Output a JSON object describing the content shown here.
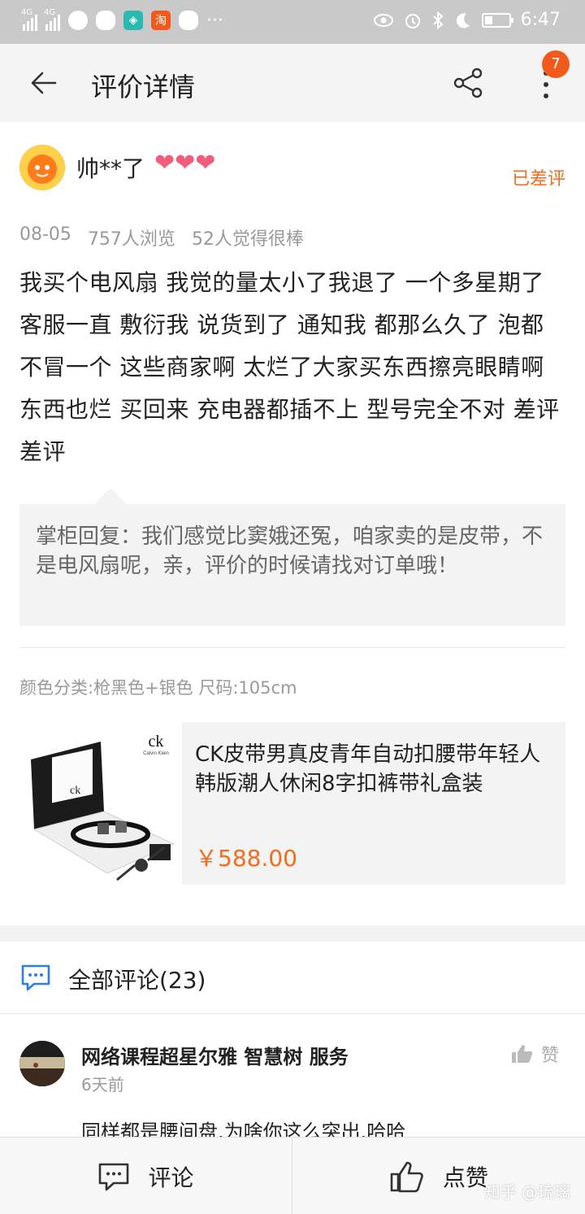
{
  "status_bar": {
    "net1": "4G",
    "net2": "4G",
    "taobao_app_label": "淘",
    "time": "6:47"
  },
  "app_bar": {
    "title": "评价详情",
    "badge_count": "7"
  },
  "review": {
    "username": "帅**了",
    "status": "已差评",
    "date": "08-05",
    "views": "757人浏览",
    "likes": "52人觉得很棒",
    "text": "我买个电风扇  我觉的量太小了我退了  一个多星期了  客服一直 敷衍我 说货到了  通知我  都那么久了 泡都不冒一个  这些商家啊  太烂了大家买东西擦亮眼睛啊   东西也烂 买回来  充电器都插不上  型号完全不对   差评差评",
    "reply": "掌柜回复：我们感觉比窦娥还冤，咱家卖的是皮带，不是电风扇呢，亲，评价的时候请找对订单哦！",
    "sku": "颜色分类:枪黑色+银色 尺码:105cm"
  },
  "product": {
    "brand_mark": "ck",
    "brand_sub": "Calvin Klein",
    "title": "CK皮带男真皮青年自动扣腰带年轻人韩版潮人休闲8字扣裤带礼盒装",
    "price": "￥588.00"
  },
  "comments": {
    "header": "全部评论(23)",
    "items": [
      {
        "name": "网络课程超星尔雅 智慧树 服务",
        "time": "6天前",
        "like_label": "赞",
        "text": "同样都是腰间盘.为啥你这么突出.哈哈"
      }
    ]
  },
  "bottom_bar": {
    "comment_label": "评论",
    "like_label": "点赞"
  },
  "watermark": "知乎 @琉璃",
  "colors": {
    "accent": "#f36b1b",
    "badge": "#f25a1b",
    "heart": "#f25b7a",
    "status_bar_bg": "#c9c9c9",
    "muted_text": "#999999",
    "comment_icon": "#2b7de9"
  }
}
